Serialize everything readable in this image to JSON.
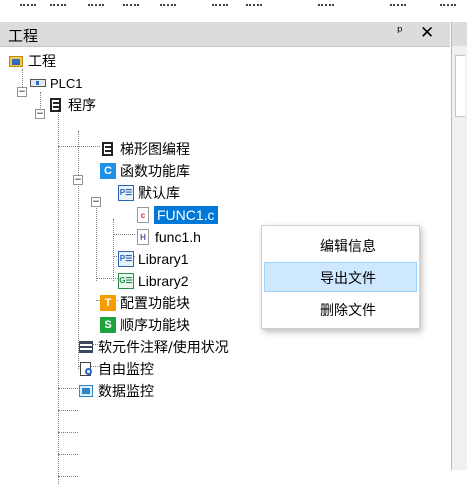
{
  "panel": {
    "title": "工程",
    "pin_glyph": "ᵖ",
    "close_glyph": "✕"
  },
  "tree": {
    "root": "工程",
    "plc": "PLC1",
    "program": "程序",
    "ladder": "梯形图编程",
    "func_lib": "函数功能库",
    "default_lib": "默认库",
    "file_c": "FUNC1.c",
    "file_h": "func1.h",
    "library1": "Library1",
    "library2": "Library2",
    "config_fb": "配置功能块",
    "seq_fb": "顺序功能块",
    "soft_comp": "软元件注释/使用状况",
    "free_monitor": "自由监控",
    "data_monitor": "数据监控",
    "icons": {
      "func_lib": "C",
      "config_fb": "T",
      "seq_fb": "S",
      "lib": "P☰",
      "lib_g": "G☰",
      "file_c": "c",
      "file_h": "H"
    }
  },
  "context_menu": {
    "items": [
      "编辑信息",
      "导出文件",
      "删除文件"
    ],
    "highlighted": "导出文件"
  },
  "colors": {
    "selection": "#0078d7",
    "menu_hover": "#cde8ff"
  }
}
